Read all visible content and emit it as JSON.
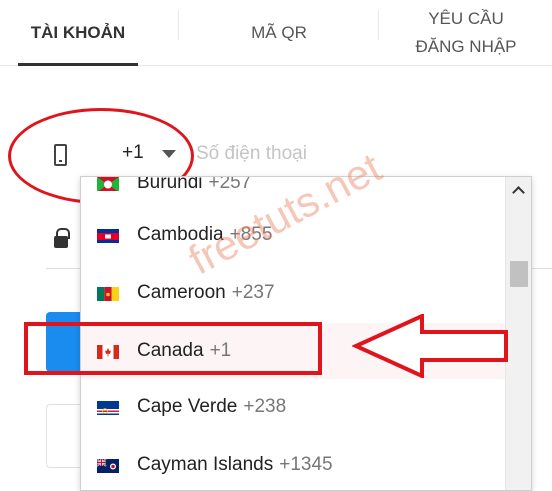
{
  "tabs": [
    {
      "label": "TÀI KHOẢN",
      "active": true
    },
    {
      "label": "MÃ QR",
      "active": false
    },
    {
      "label_line1": "YÊU CẦU",
      "label_line2": "ĐĂNG NHẬP",
      "active": false
    }
  ],
  "phone": {
    "country_code": "+1",
    "placeholder": "Số điện thoại"
  },
  "dropdown": {
    "items": [
      {
        "name": "Burundi",
        "code": "+257",
        "flag": "burundi-flag"
      },
      {
        "name": "Cambodia",
        "code": "+855",
        "flag": "cambodia-flag"
      },
      {
        "name": "Cameroon",
        "code": "+237",
        "flag": "cameroon-flag"
      },
      {
        "name": "Canada",
        "code": "+1",
        "flag": "canada-flag",
        "highlighted": true
      },
      {
        "name": "Cape Verde",
        "code": "+238",
        "flag": "cape-verde-flag"
      },
      {
        "name": "Cayman Islands",
        "code": "+1345",
        "flag": "cayman-islands-flag"
      }
    ]
  },
  "watermark": "freetuts.net",
  "colors": {
    "annotation_red": "#e0141c",
    "primary_blue": "#1a8cf0",
    "tab_active": "#333333"
  }
}
